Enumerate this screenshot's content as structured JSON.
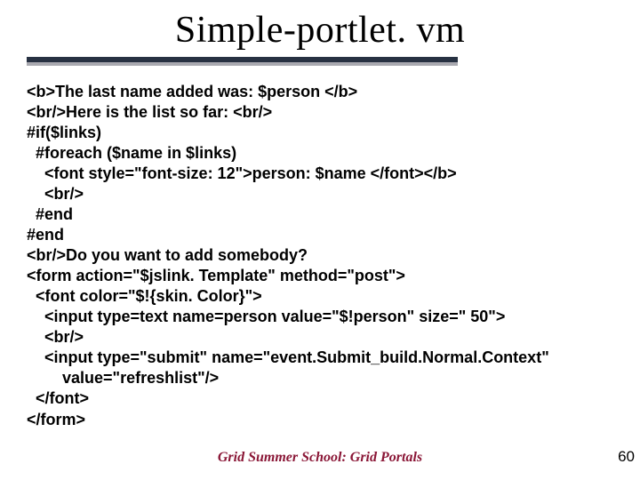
{
  "slide": {
    "title": "Simple-portlet. vm",
    "footer": "Grid Summer School: Grid Portals",
    "page_number": "60"
  },
  "code_lines": {
    "l0": "<b>The last name added was: $person </b>",
    "l1": "<br/>Here is the list so far: <br/>",
    "l2": "#if($links)",
    "l3": "  #foreach ($name in $links)",
    "l4": "    <font style=\"font-size: 12\">person: $name </font></b>",
    "l5": "    <br/>",
    "l6": "  #end",
    "l7": "#end",
    "l8": "<br/>Do you want to add somebody?",
    "l9": "<form action=\"$jslink. Template\" method=\"post\">",
    "l10": "  <font color=\"$!{skin. Color}\">",
    "l11": "    <input type=text name=person value=\"$!person\" size=\" 50\">",
    "l12": "    <br/>",
    "l13": "    <input type=\"submit\" name=\"event.Submit_build.Normal.Context\"",
    "l14": "        value=\"refreshlist\"/>",
    "l15": "  </font>",
    "l16": "</form>"
  }
}
